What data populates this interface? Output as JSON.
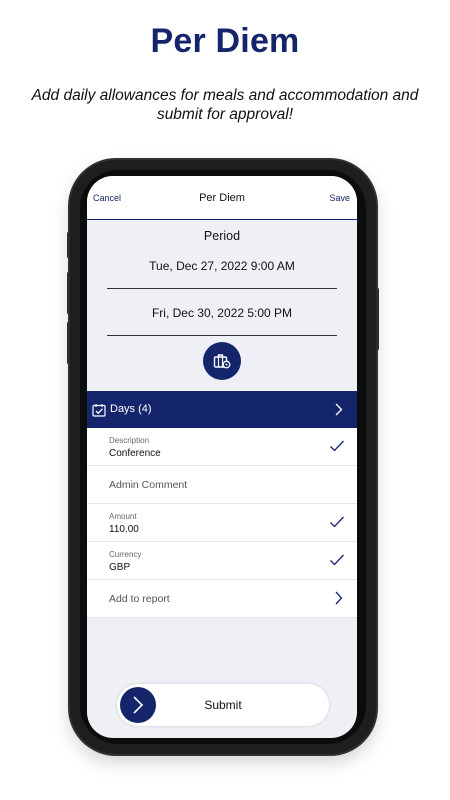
{
  "promo": {
    "headline": "Per Diem",
    "subline": "Add daily allowances for meals and accommodation and submit for approval!"
  },
  "navbar": {
    "cancel_label": "Cancel",
    "title": "Per Diem",
    "save_label": "Save"
  },
  "period": {
    "label": "Period",
    "start": "Tue, Dec 27, 2022 9:00 AM",
    "end": "Fri, Dec 30, 2022 5:00 PM"
  },
  "days": {
    "label": "Days (4)",
    "icon": "calendar-check-icon"
  },
  "fields": [
    {
      "label": "Description",
      "value": "Conference",
      "validated": true
    },
    {
      "label": "Admin Comment"
    },
    {
      "label": "Amount",
      "value": "110.00",
      "validated": true
    },
    {
      "label": "Currency",
      "value": "GBP",
      "validated": true
    },
    {
      "label": "Add to report"
    }
  ],
  "submit": {
    "label": "Submit",
    "icon": "chevron-right-icon"
  },
  "colors": {
    "brand": "#14256b",
    "screen_bg": "#eef0f5",
    "phone_frame": "#1c1f1e"
  }
}
